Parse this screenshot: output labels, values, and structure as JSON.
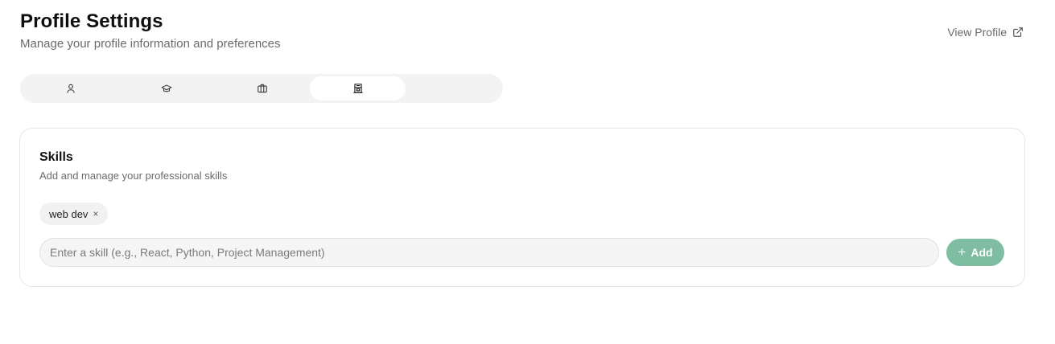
{
  "header": {
    "title": "Profile Settings",
    "subtitle": "Manage your profile information and preferences",
    "view_profile_label": "View Profile"
  },
  "tabs": [
    {
      "icon": "user-icon",
      "active": false
    },
    {
      "icon": "graduation-cap-icon",
      "active": false
    },
    {
      "icon": "briefcase-icon",
      "active": false
    },
    {
      "icon": "building-icon",
      "active": true
    }
  ],
  "skills": {
    "title": "Skills",
    "description": "Add and manage your professional skills",
    "items": [
      {
        "label": "web dev",
        "remove": "×"
      }
    ],
    "input_placeholder": "Enter a skill (e.g., React, Python, Project Management)",
    "input_value": "",
    "add_label": "Add",
    "add_icon": "+"
  },
  "colors": {
    "accent": "#7fbda3",
    "tab_track": "#f3f3f3",
    "text_muted": "#6b6b6b"
  }
}
